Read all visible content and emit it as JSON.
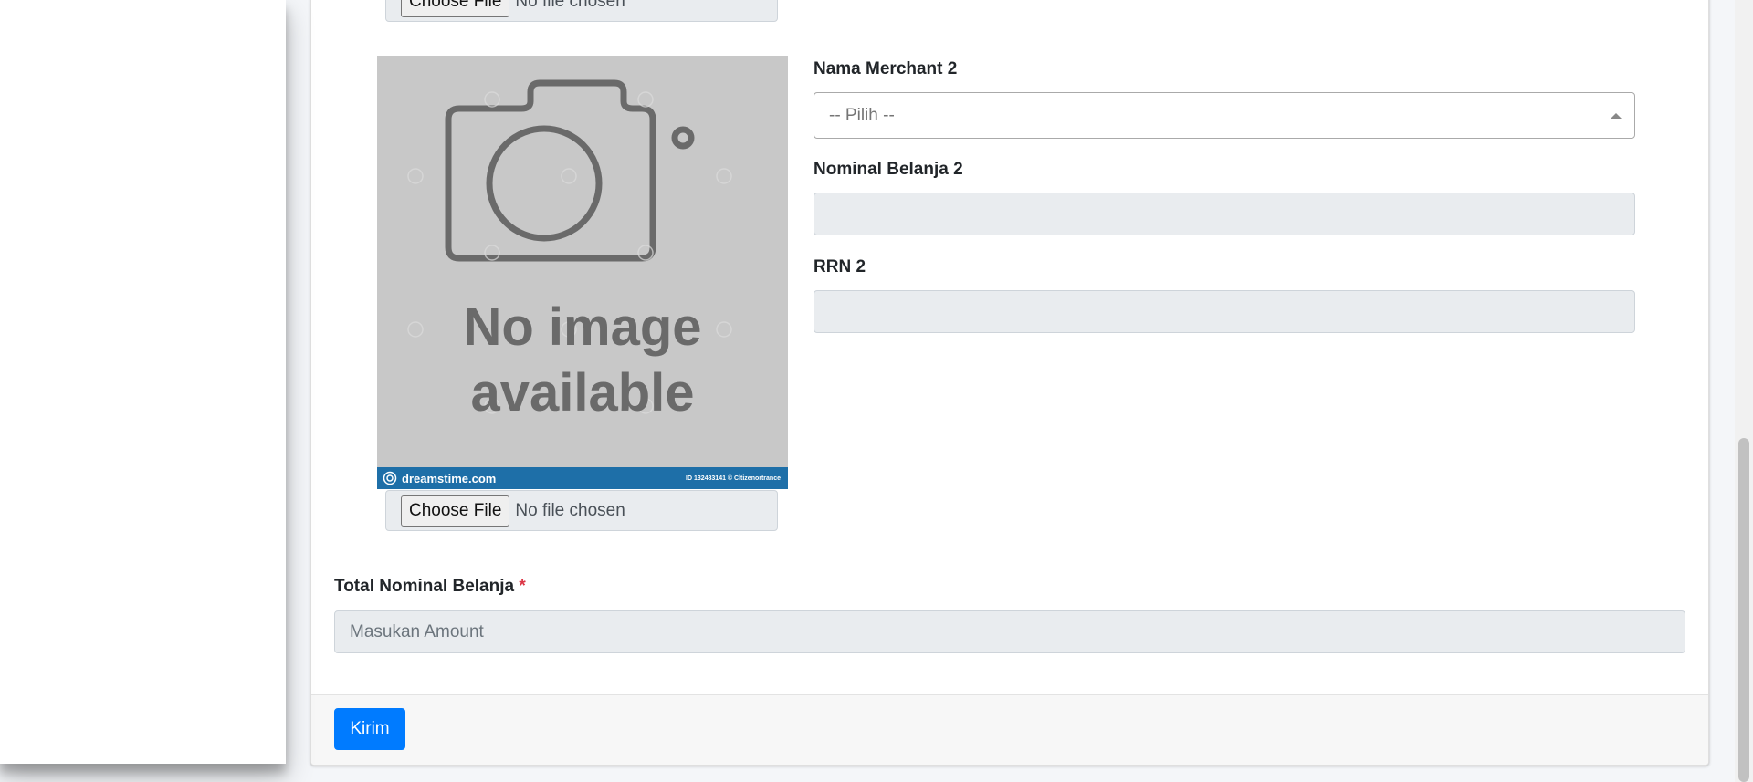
{
  "uploads": [
    {
      "button_label": "Choose File",
      "status": "No file chosen"
    },
    {
      "button_label": "Choose File",
      "status": "No file chosen"
    }
  ],
  "preview_image": {
    "line1": "No image",
    "line2": "available",
    "brand": "dreamstime.com",
    "credit": "ID 132483141 © Cltizenortrance"
  },
  "merchant2": {
    "nama_label": "Nama Merchant 2",
    "select_placeholder": "-- Pilih --",
    "nominal_label": "Nominal Belanja 2",
    "nominal_value": "",
    "rrn_label": "RRN 2",
    "rrn_value": ""
  },
  "total": {
    "label": "Total Nominal Belanja",
    "required_mark": "*",
    "placeholder": "Masukan Amount"
  },
  "footer": {
    "submit_label": "Kirim"
  },
  "colors": {
    "primary": "#007bff",
    "required": "#dc3545",
    "readonly_bg": "#e9ecef"
  }
}
